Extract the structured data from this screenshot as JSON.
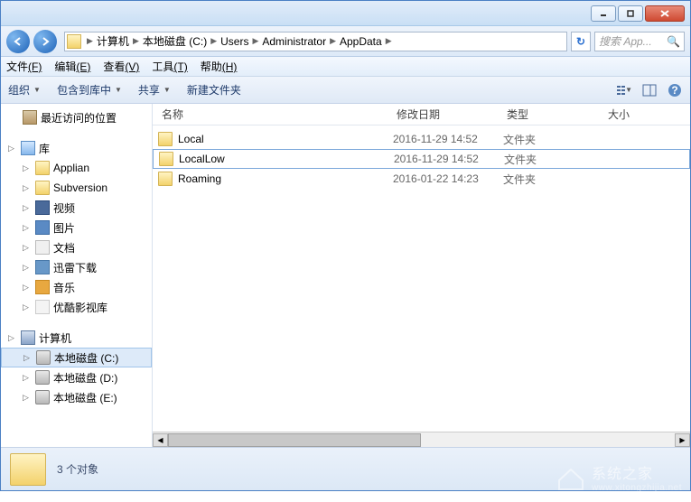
{
  "titlebar": {
    "minimize": "minimize",
    "maximize": "maximize",
    "close": "close"
  },
  "nav": {
    "back": "back",
    "forward": "forward",
    "refresh": "↻",
    "search_placeholder": "搜索 App...",
    "breadcrumbs": [
      "计算机",
      "本地磁盘 (C:)",
      "Users",
      "Administrator",
      "AppData"
    ]
  },
  "menu": {
    "file": "文件",
    "file_key": "(F)",
    "edit": "编辑",
    "edit_key": "(E)",
    "view": "查看",
    "view_key": "(V)",
    "tools": "工具",
    "tools_key": "(T)",
    "help": "帮助",
    "help_key": "(H)"
  },
  "toolbar": {
    "organize": "组织",
    "include": "包含到库中",
    "share": "共享",
    "newfolder": "新建文件夹"
  },
  "sidebar": {
    "recent": "最近访问的位置",
    "libraries": "库",
    "lib_items": [
      "Applian",
      "Subversion",
      "视频",
      "图片",
      "文档",
      "迅雷下载",
      "音乐",
      "优酷影视库"
    ],
    "computer": "计算机",
    "drives": [
      "本地磁盘 (C:)",
      "本地磁盘 (D:)",
      "本地磁盘 (E:)"
    ]
  },
  "columns": {
    "name": "名称",
    "date": "修改日期",
    "type": "类型",
    "size": "大小"
  },
  "files": [
    {
      "name": "Local",
      "date": "2016-11-29 14:52",
      "type": "文件夹"
    },
    {
      "name": "LocalLow",
      "date": "2016-11-29 14:52",
      "type": "文件夹"
    },
    {
      "name": "Roaming",
      "date": "2016-01-22 14:23",
      "type": "文件夹"
    }
  ],
  "status": {
    "count": "3 个对象"
  },
  "watermark": {
    "name": "系统之家",
    "url": "www.xitongzhijia.net"
  }
}
